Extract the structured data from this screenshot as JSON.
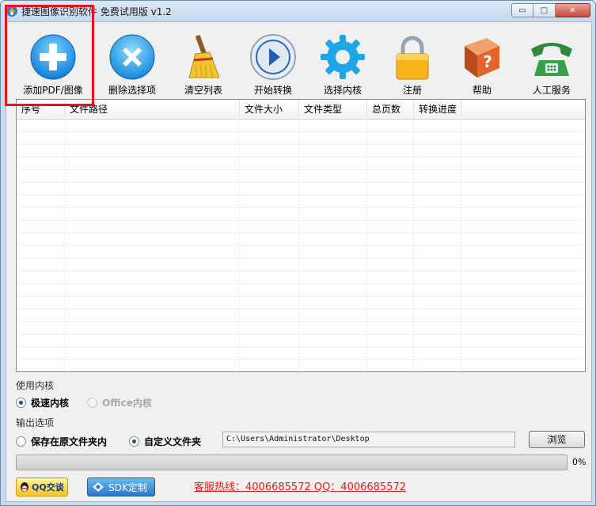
{
  "window": {
    "title": "捷速图像识别软件 免费试用版 v1.2",
    "controls": {
      "minimize": "▭",
      "maximize": "□",
      "close": "✕"
    }
  },
  "toolbar": {
    "items": [
      {
        "label": "添加PDF/图像",
        "icon": "add-icon"
      },
      {
        "label": "删除选择项",
        "icon": "delete-icon"
      },
      {
        "label": "清空列表",
        "icon": "broom-icon"
      },
      {
        "label": "开始转换",
        "icon": "play-icon"
      },
      {
        "label": "选择内核",
        "icon": "gear-icon"
      },
      {
        "label": "注册",
        "icon": "lock-icon"
      },
      {
        "label": "帮助",
        "icon": "help-book-icon"
      },
      {
        "label": "人工服务",
        "icon": "phone-icon"
      }
    ]
  },
  "file_list": {
    "columns": [
      "序号",
      "文件路径",
      "文件大小",
      "文件类型",
      "总页数",
      "转换进度"
    ]
  },
  "engine": {
    "section_label": "使用内核",
    "options": [
      {
        "label": "极速内核",
        "checked": true,
        "disabled": false
      },
      {
        "label": "Office内核",
        "checked": false,
        "disabled": true
      }
    ]
  },
  "output": {
    "section_label": "输出选项",
    "options": [
      {
        "label": "保存在原文件夹内",
        "checked": false
      },
      {
        "label": "自定义文件夹",
        "checked": true
      }
    ],
    "path_value": "C:\\Users\\Administrator\\Desktop",
    "browse_label": "浏览"
  },
  "progress": {
    "value": 0,
    "text": "0%"
  },
  "footer": {
    "qq_label": "QQ交谈",
    "sdk_label": "SDK定制",
    "hotline": "客服热线：4006685572 QQ：4006685572"
  },
  "colors": {
    "highlight": "#e8121c",
    "hotline": "#e31b1b"
  }
}
